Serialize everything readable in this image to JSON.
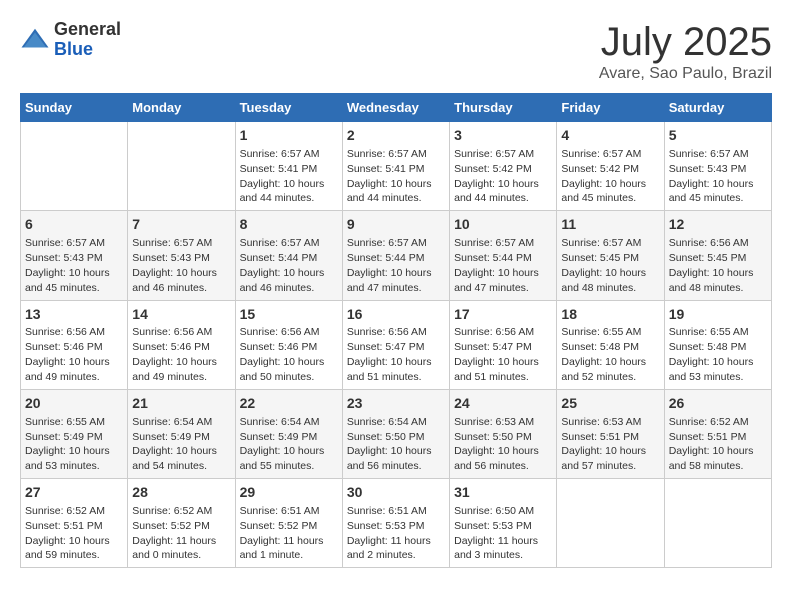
{
  "header": {
    "logo_general": "General",
    "logo_blue": "Blue",
    "title": "July 2025",
    "subtitle": "Avare, Sao Paulo, Brazil"
  },
  "days_of_week": [
    "Sunday",
    "Monday",
    "Tuesday",
    "Wednesday",
    "Thursday",
    "Friday",
    "Saturday"
  ],
  "weeks": [
    [
      {
        "day": "",
        "sunrise": "",
        "sunset": "",
        "daylight": ""
      },
      {
        "day": "",
        "sunrise": "",
        "sunset": "",
        "daylight": ""
      },
      {
        "day": "1",
        "sunrise": "Sunrise: 6:57 AM",
        "sunset": "Sunset: 5:41 PM",
        "daylight": "Daylight: 10 hours and 44 minutes."
      },
      {
        "day": "2",
        "sunrise": "Sunrise: 6:57 AM",
        "sunset": "Sunset: 5:41 PM",
        "daylight": "Daylight: 10 hours and 44 minutes."
      },
      {
        "day": "3",
        "sunrise": "Sunrise: 6:57 AM",
        "sunset": "Sunset: 5:42 PM",
        "daylight": "Daylight: 10 hours and 44 minutes."
      },
      {
        "day": "4",
        "sunrise": "Sunrise: 6:57 AM",
        "sunset": "Sunset: 5:42 PM",
        "daylight": "Daylight: 10 hours and 45 minutes."
      },
      {
        "day": "5",
        "sunrise": "Sunrise: 6:57 AM",
        "sunset": "Sunset: 5:43 PM",
        "daylight": "Daylight: 10 hours and 45 minutes."
      }
    ],
    [
      {
        "day": "6",
        "sunrise": "Sunrise: 6:57 AM",
        "sunset": "Sunset: 5:43 PM",
        "daylight": "Daylight: 10 hours and 45 minutes."
      },
      {
        "day": "7",
        "sunrise": "Sunrise: 6:57 AM",
        "sunset": "Sunset: 5:43 PM",
        "daylight": "Daylight: 10 hours and 46 minutes."
      },
      {
        "day": "8",
        "sunrise": "Sunrise: 6:57 AM",
        "sunset": "Sunset: 5:44 PM",
        "daylight": "Daylight: 10 hours and 46 minutes."
      },
      {
        "day": "9",
        "sunrise": "Sunrise: 6:57 AM",
        "sunset": "Sunset: 5:44 PM",
        "daylight": "Daylight: 10 hours and 47 minutes."
      },
      {
        "day": "10",
        "sunrise": "Sunrise: 6:57 AM",
        "sunset": "Sunset: 5:44 PM",
        "daylight": "Daylight: 10 hours and 47 minutes."
      },
      {
        "day": "11",
        "sunrise": "Sunrise: 6:57 AM",
        "sunset": "Sunset: 5:45 PM",
        "daylight": "Daylight: 10 hours and 48 minutes."
      },
      {
        "day": "12",
        "sunrise": "Sunrise: 6:56 AM",
        "sunset": "Sunset: 5:45 PM",
        "daylight": "Daylight: 10 hours and 48 minutes."
      }
    ],
    [
      {
        "day": "13",
        "sunrise": "Sunrise: 6:56 AM",
        "sunset": "Sunset: 5:46 PM",
        "daylight": "Daylight: 10 hours and 49 minutes."
      },
      {
        "day": "14",
        "sunrise": "Sunrise: 6:56 AM",
        "sunset": "Sunset: 5:46 PM",
        "daylight": "Daylight: 10 hours and 49 minutes."
      },
      {
        "day": "15",
        "sunrise": "Sunrise: 6:56 AM",
        "sunset": "Sunset: 5:46 PM",
        "daylight": "Daylight: 10 hours and 50 minutes."
      },
      {
        "day": "16",
        "sunrise": "Sunrise: 6:56 AM",
        "sunset": "Sunset: 5:47 PM",
        "daylight": "Daylight: 10 hours and 51 minutes."
      },
      {
        "day": "17",
        "sunrise": "Sunrise: 6:56 AM",
        "sunset": "Sunset: 5:47 PM",
        "daylight": "Daylight: 10 hours and 51 minutes."
      },
      {
        "day": "18",
        "sunrise": "Sunrise: 6:55 AM",
        "sunset": "Sunset: 5:48 PM",
        "daylight": "Daylight: 10 hours and 52 minutes."
      },
      {
        "day": "19",
        "sunrise": "Sunrise: 6:55 AM",
        "sunset": "Sunset: 5:48 PM",
        "daylight": "Daylight: 10 hours and 53 minutes."
      }
    ],
    [
      {
        "day": "20",
        "sunrise": "Sunrise: 6:55 AM",
        "sunset": "Sunset: 5:49 PM",
        "daylight": "Daylight: 10 hours and 53 minutes."
      },
      {
        "day": "21",
        "sunrise": "Sunrise: 6:54 AM",
        "sunset": "Sunset: 5:49 PM",
        "daylight": "Daylight: 10 hours and 54 minutes."
      },
      {
        "day": "22",
        "sunrise": "Sunrise: 6:54 AM",
        "sunset": "Sunset: 5:49 PM",
        "daylight": "Daylight: 10 hours and 55 minutes."
      },
      {
        "day": "23",
        "sunrise": "Sunrise: 6:54 AM",
        "sunset": "Sunset: 5:50 PM",
        "daylight": "Daylight: 10 hours and 56 minutes."
      },
      {
        "day": "24",
        "sunrise": "Sunrise: 6:53 AM",
        "sunset": "Sunset: 5:50 PM",
        "daylight": "Daylight: 10 hours and 56 minutes."
      },
      {
        "day": "25",
        "sunrise": "Sunrise: 6:53 AM",
        "sunset": "Sunset: 5:51 PM",
        "daylight": "Daylight: 10 hours and 57 minutes."
      },
      {
        "day": "26",
        "sunrise": "Sunrise: 6:52 AM",
        "sunset": "Sunset: 5:51 PM",
        "daylight": "Daylight: 10 hours and 58 minutes."
      }
    ],
    [
      {
        "day": "27",
        "sunrise": "Sunrise: 6:52 AM",
        "sunset": "Sunset: 5:51 PM",
        "daylight": "Daylight: 10 hours and 59 minutes."
      },
      {
        "day": "28",
        "sunrise": "Sunrise: 6:52 AM",
        "sunset": "Sunset: 5:52 PM",
        "daylight": "Daylight: 11 hours and 0 minutes."
      },
      {
        "day": "29",
        "sunrise": "Sunrise: 6:51 AM",
        "sunset": "Sunset: 5:52 PM",
        "daylight": "Daylight: 11 hours and 1 minute."
      },
      {
        "day": "30",
        "sunrise": "Sunrise: 6:51 AM",
        "sunset": "Sunset: 5:53 PM",
        "daylight": "Daylight: 11 hours and 2 minutes."
      },
      {
        "day": "31",
        "sunrise": "Sunrise: 6:50 AM",
        "sunset": "Sunset: 5:53 PM",
        "daylight": "Daylight: 11 hours and 3 minutes."
      },
      {
        "day": "",
        "sunrise": "",
        "sunset": "",
        "daylight": ""
      },
      {
        "day": "",
        "sunrise": "",
        "sunset": "",
        "daylight": ""
      }
    ]
  ]
}
